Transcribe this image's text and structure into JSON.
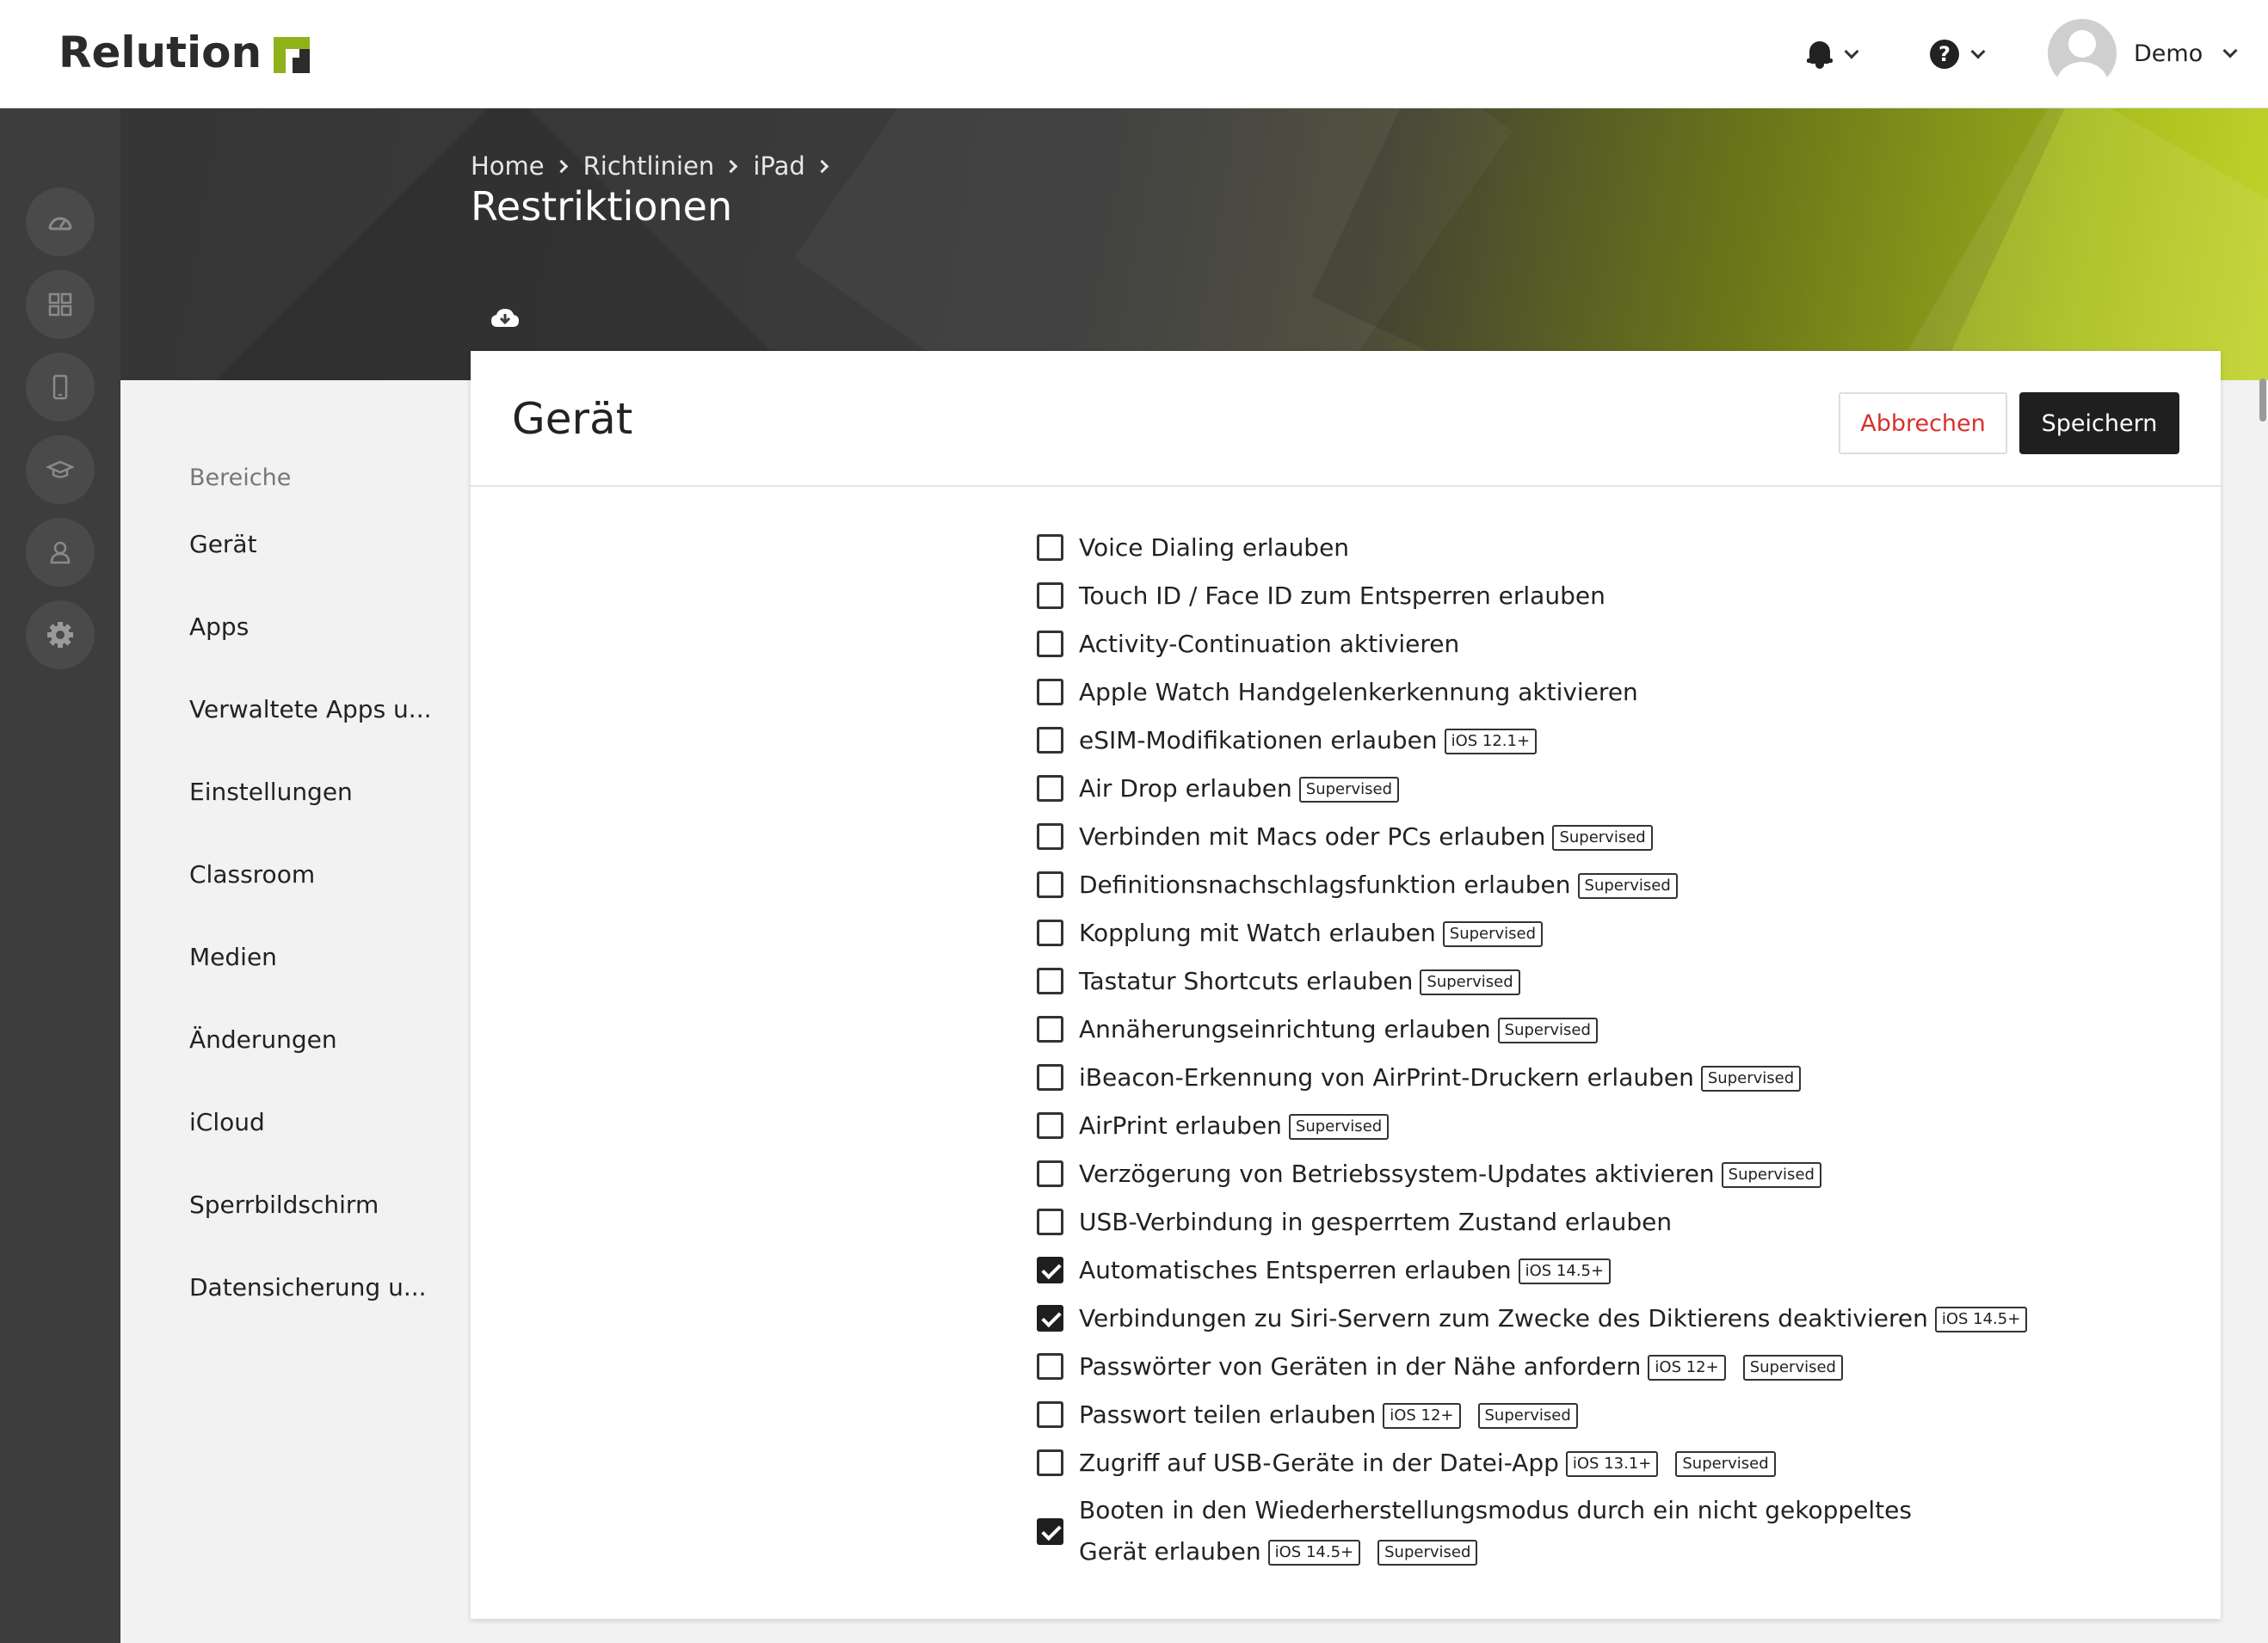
{
  "app": {
    "brand": "Relution",
    "accent": "#8fb21b"
  },
  "topbar": {
    "user_name": "Demo"
  },
  "breadcrumb": [
    "Home",
    "Richtlinien",
    "iPad"
  ],
  "page_title": "Restriktionen",
  "sections": {
    "header": "Bereiche",
    "items": [
      "Gerät",
      "Apps",
      "Verwaltete Apps u...",
      "Einstellungen",
      "Classroom",
      "Medien",
      "Änderungen",
      "iCloud",
      "Sperrbildschirm",
      "Datensicherung u..."
    ]
  },
  "card": {
    "title": "Gerät",
    "cancel_label": "Abbrechen",
    "save_label": "Speichern"
  },
  "restrictions": [
    {
      "label": "Voice Dialing erlauben",
      "checked": false,
      "badges": []
    },
    {
      "label": "Touch ID / Face ID zum Entsperren erlauben",
      "checked": false,
      "badges": []
    },
    {
      "label": "Activity-Continuation aktivieren",
      "checked": false,
      "badges": []
    },
    {
      "label": "Apple Watch Handgelenkerkennung aktivieren",
      "checked": false,
      "badges": []
    },
    {
      "label": "eSIM-Modifikationen erlauben",
      "checked": false,
      "badges": [
        "iOS 12.1+"
      ]
    },
    {
      "label": "Air Drop erlauben",
      "checked": false,
      "badges": [
        "Supervised"
      ]
    },
    {
      "label": "Verbinden mit Macs oder PCs erlauben",
      "checked": false,
      "badges": [
        "Supervised"
      ]
    },
    {
      "label": "Definitionsnachschlagsfunktion erlauben",
      "checked": false,
      "badges": [
        "Supervised"
      ]
    },
    {
      "label": "Kopplung mit Watch erlauben",
      "checked": false,
      "badges": [
        "Supervised"
      ]
    },
    {
      "label": "Tastatur Shortcuts erlauben",
      "checked": false,
      "badges": [
        "Supervised"
      ]
    },
    {
      "label": "Annäherungseinrichtung erlauben",
      "checked": false,
      "badges": [
        "Supervised"
      ]
    },
    {
      "label": "iBeacon-Erkennung von AirPrint-Druckern erlauben",
      "checked": false,
      "badges": [
        "Supervised"
      ]
    },
    {
      "label": "AirPrint erlauben",
      "checked": false,
      "badges": [
        "Supervised"
      ]
    },
    {
      "label": "Verzögerung von Betriebssystem-Updates aktivieren",
      "checked": false,
      "badges": [
        "Supervised"
      ]
    },
    {
      "label": "USB-Verbindung in gesperrtem Zustand erlauben",
      "checked": false,
      "badges": []
    },
    {
      "label": "Automatisches Entsperren erlauben",
      "checked": true,
      "badges": [
        "iOS 14.5+"
      ]
    },
    {
      "label": "Verbindungen zu Siri-Servern zum Zwecke des Diktierens deaktivieren",
      "checked": true,
      "badges": [
        "iOS 14.5+"
      ]
    },
    {
      "label": "Passwörter von Geräten in der Nähe anfordern",
      "checked": false,
      "badges": [
        "iOS 12+",
        "Supervised"
      ]
    },
    {
      "label": "Passwort teilen erlauben",
      "checked": false,
      "badges": [
        "iOS 12+",
        "Supervised"
      ]
    },
    {
      "label": "Zugriff auf USB-Geräte in der Datei-App",
      "checked": false,
      "badges": [
        "iOS 13.1+",
        "Supervised"
      ]
    },
    {
      "label": "Booten in den Wiederherstellungsmodus durch ein nicht gekoppeltes Gerät erlauben",
      "checked": true,
      "badges": [
        "iOS 14.5+",
        "Supervised"
      ],
      "wrap": true
    }
  ],
  "icons": {
    "rail": [
      "dashboard-icon",
      "apps-grid-icon",
      "device-icon",
      "education-icon",
      "user-icon",
      "settings-gear-icon"
    ],
    "topbar": [
      "bell-icon",
      "help-icon",
      "avatar"
    ],
    "hero": "cloud-download-icon"
  }
}
